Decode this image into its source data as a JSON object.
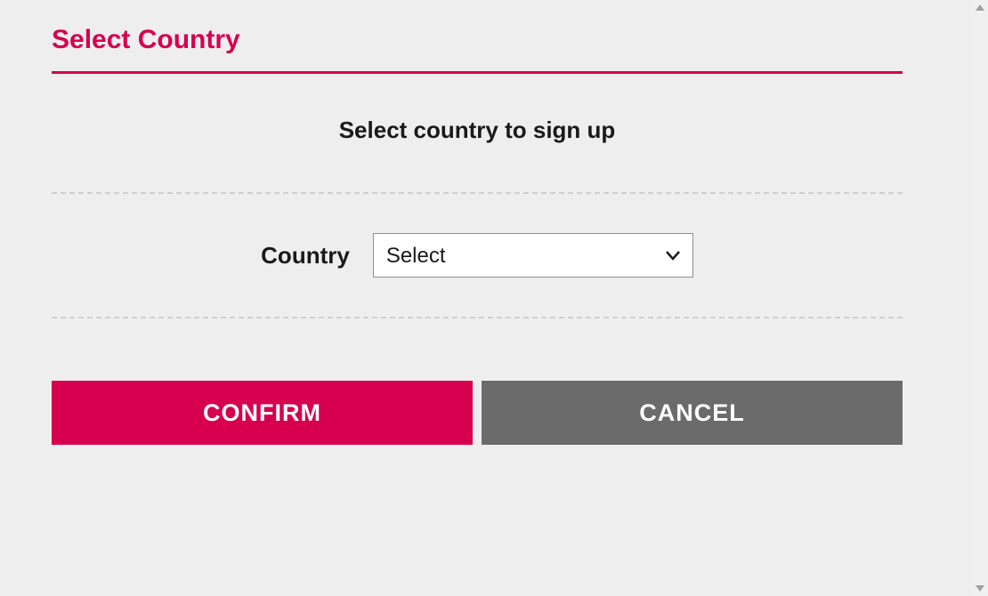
{
  "header": {
    "title": "Select Country"
  },
  "main": {
    "subtitle": "Select country to sign up",
    "field_label": "Country",
    "select_value": "Select"
  },
  "buttons": {
    "confirm": "CONFIRM",
    "cancel": "CANCEL"
  },
  "colors": {
    "accent": "#d6004e",
    "secondary": "#6b6b6b"
  }
}
